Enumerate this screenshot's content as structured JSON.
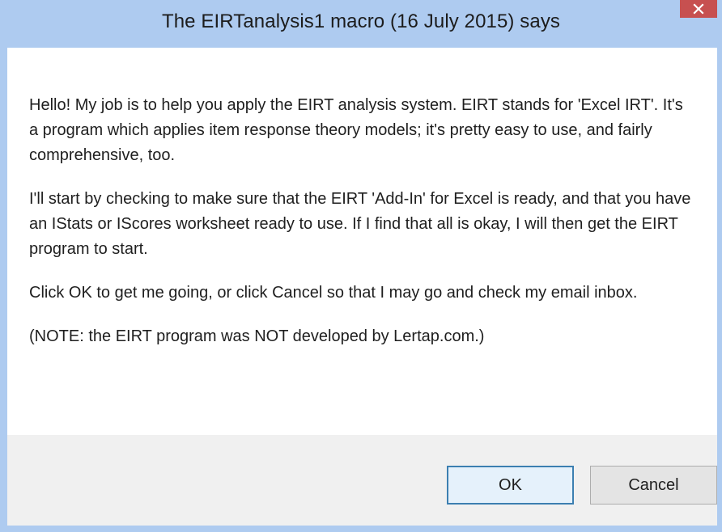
{
  "dialog": {
    "title": "The EIRTanalysis1 macro (16 July 2015) says",
    "close_icon": "close-icon",
    "paragraphs": [
      "Hello!  My job is to help you apply the EIRT analysis system.  EIRT stands for 'Excel IRT'.  It's a program which applies item response theory models; it's pretty easy to use, and fairly comprehensive, too.",
      "I'll start by checking to make sure that the EIRT 'Add-In' for Excel is ready, and that you have an IStats or IScores worksheet ready to use.  If I find that all is okay, I will then get the EIRT program to start.",
      "Click OK to get me going, or click Cancel so that I may go and check my email inbox.",
      "(NOTE: the EIRT program was NOT developed by Lertap.com.)"
    ],
    "ok_label": "OK",
    "cancel_label": "Cancel"
  },
  "colors": {
    "titlebar": "#aecbf0",
    "close_button": "#c75050",
    "footer": "#f0f0f0",
    "default_button_border": "#3c7fb1"
  }
}
